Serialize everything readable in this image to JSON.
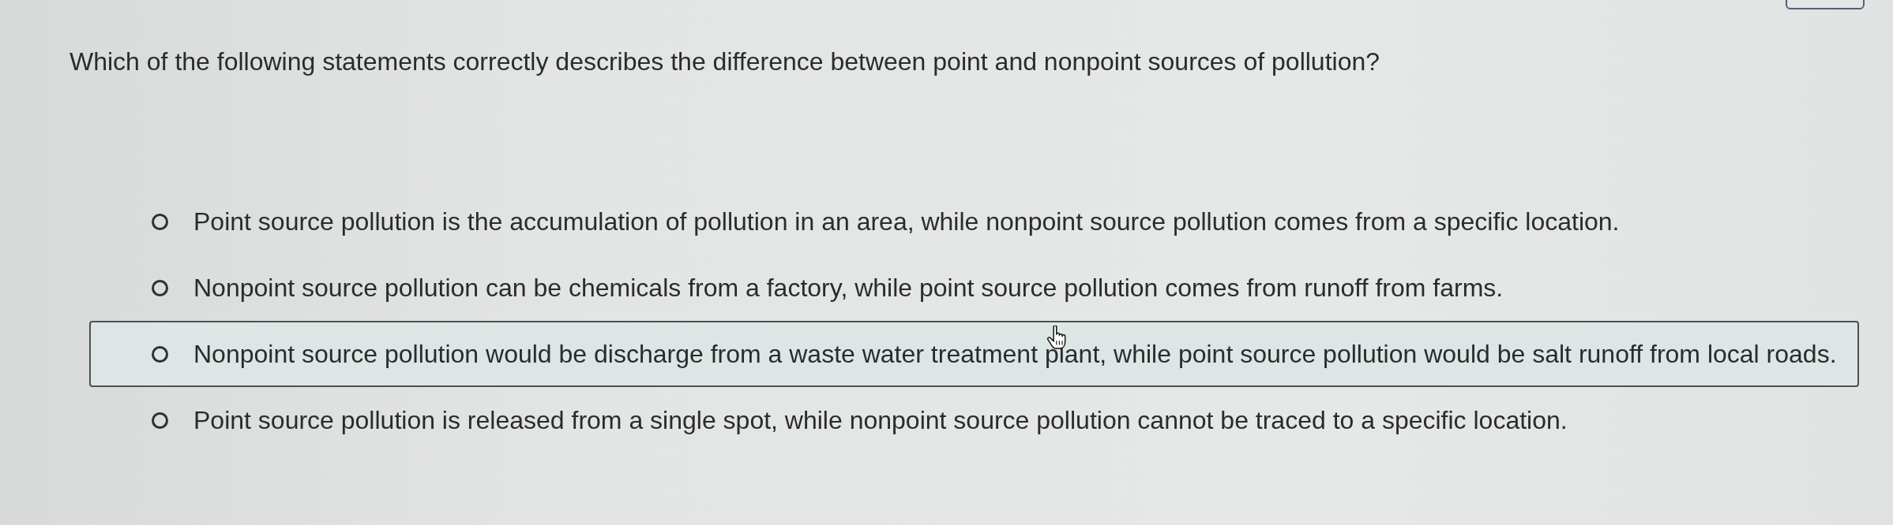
{
  "question": "Which of the following statements correctly describes the difference between point and nonpoint sources of pollution?",
  "options": [
    {
      "text": "Point source pollution is the accumulation of pollution in an area, while nonpoint source pollution comes from a specific location.",
      "selected": false,
      "hovered": false
    },
    {
      "text": "Nonpoint source pollution can be chemicals from a factory, while point source pollution comes from runoff from farms.",
      "selected": false,
      "hovered": false
    },
    {
      "text": "Nonpoint source pollution would be discharge from a waste water treatment plant, while point source pollution would be salt runoff from local roads.",
      "selected": false,
      "hovered": true
    },
    {
      "text": "Point source pollution is released from a single spot, while nonpoint source pollution cannot be traced to a specific location.",
      "selected": false,
      "hovered": false
    }
  ]
}
